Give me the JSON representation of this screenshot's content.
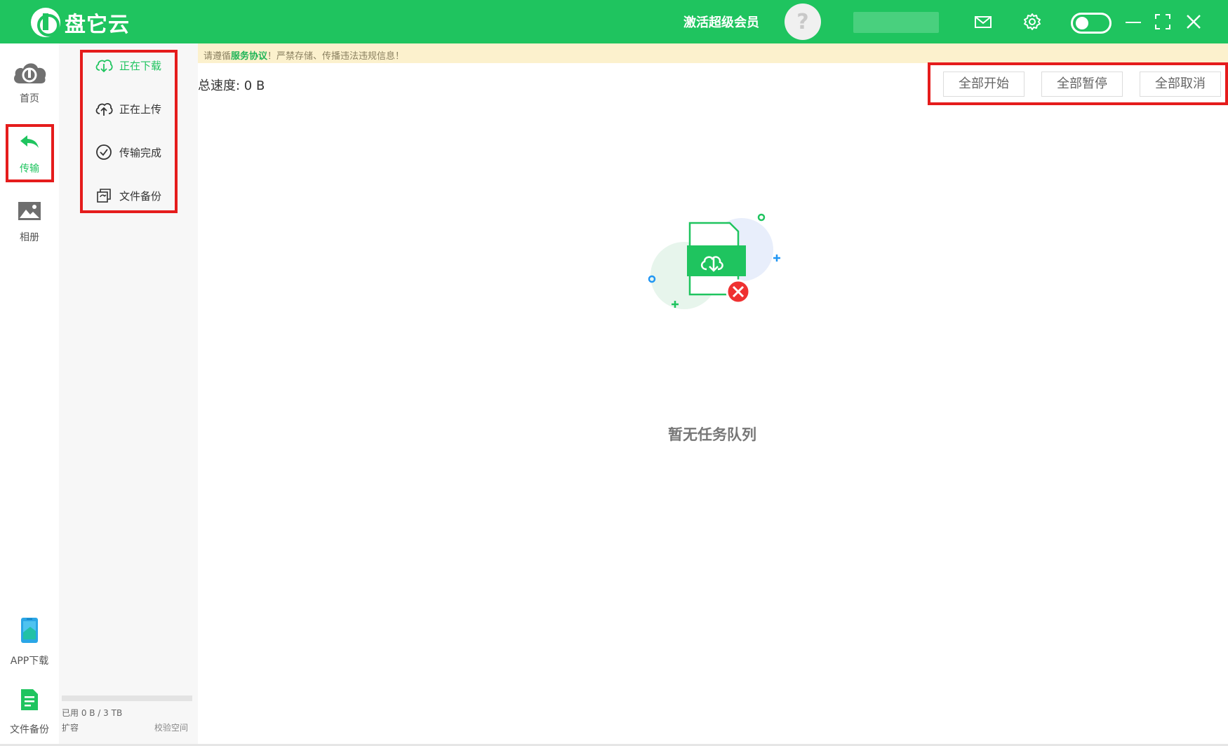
{
  "app": {
    "title": "盘它云"
  },
  "header": {
    "vip_label": "激活超级会员",
    "avatar_glyph": "?"
  },
  "nav": {
    "items": [
      {
        "id": "home",
        "label": "首页",
        "icon": "cloud-icon"
      },
      {
        "id": "transfer",
        "label": "传输",
        "icon": "transfer-arrow-icon",
        "active": true
      },
      {
        "id": "album",
        "label": "相册",
        "icon": "image-icon"
      },
      {
        "id": "app",
        "label": "APP下载",
        "icon": "phone-icon"
      },
      {
        "id": "backup",
        "label": "文件备份",
        "icon": "document-icon"
      }
    ]
  },
  "subnav": {
    "items": [
      {
        "label": "正在下载",
        "icon": "cloud-download-icon",
        "active": true
      },
      {
        "label": "正在上传",
        "icon": "cloud-upload-icon"
      },
      {
        "label": "传输完成",
        "icon": "check-circle-icon"
      },
      {
        "label": "文件备份",
        "icon": "backup-icon"
      }
    ],
    "storage": {
      "used_text": "已用 0 B / 3 TB",
      "used_fraction": 0
    },
    "expand_label": "扩容",
    "verify_label": "校验空间"
  },
  "notice": {
    "prefix": "请遵循",
    "link": "服务协议",
    "suffix": "！严禁存储、传播违法违规信息！"
  },
  "main": {
    "speed_text": "总速度: 0 B",
    "buttons": {
      "start_all": "全部开始",
      "pause_all": "全部暂停",
      "cancel_all": "全部取消"
    },
    "empty_text": "暂无任务队列"
  },
  "colors": {
    "brand": "#1fc45f",
    "highlight": "#e51c1c",
    "notice_bg": "#fcf1cd"
  }
}
